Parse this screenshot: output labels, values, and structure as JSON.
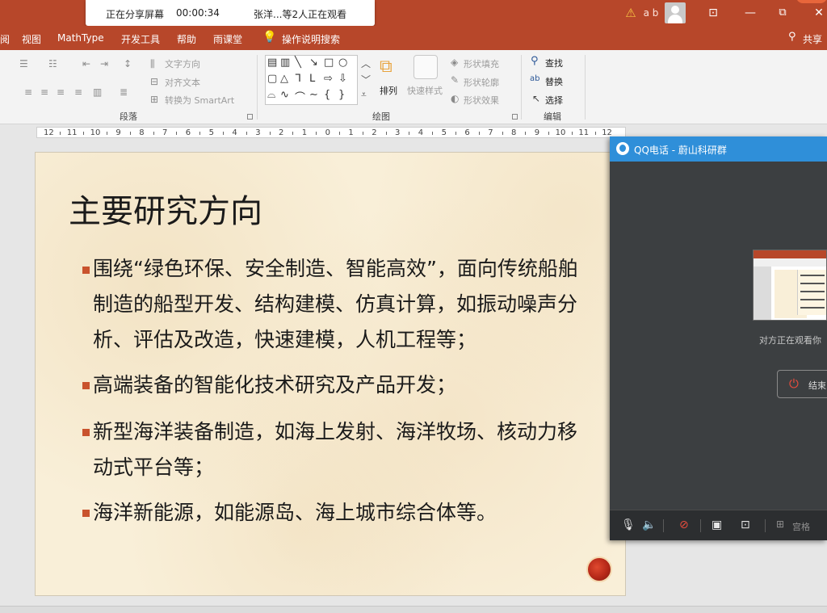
{
  "titlebar": {
    "share_status": "正在分享屏幕",
    "share_timer": "00:00:34",
    "share_viewers": "张洋...等2人正在观看",
    "user_initials": "a b",
    "warning_glyph": "⚠",
    "restore_glyph": "⧉",
    "minimize_glyph": "—",
    "close_glyph": "✕",
    "ribbon_display_glyph": "⊡"
  },
  "menu": {
    "partial_tab": "阅",
    "tabs": [
      "视图",
      "MathType",
      "开发工具",
      "帮助",
      "雨课堂"
    ],
    "search_label": "操作说明搜索",
    "share_label": "共享"
  },
  "ribbon": {
    "paragraph": {
      "label": "段落",
      "text_direction": "文字方向",
      "align_text": "对齐文本",
      "convert_smartart": "转换为 SmartArt"
    },
    "drawing": {
      "label": "绘图",
      "arrange": "排列",
      "quick_styles": "快速样式",
      "shape_fill": "形状填充",
      "shape_outline": "形状轮廓",
      "shape_effects": "形状效果"
    },
    "editing": {
      "label": "编辑",
      "find": "查找",
      "replace": "替换",
      "select": "选择"
    }
  },
  "ruler": {
    "labels": [
      "12",
      "11",
      "10",
      "9",
      "8",
      "7",
      "6",
      "5",
      "4",
      "3",
      "2",
      "1",
      "0",
      "1",
      "2",
      "3",
      "4",
      "5",
      "6",
      "7",
      "8",
      "9",
      "10",
      "11",
      "12"
    ]
  },
  "slide": {
    "title": "主要研究方向",
    "bullets": [
      "围绕“绿色环保、安全制造、智能高效”，面向传统船舶制造的船型开发、结构建模、仿真计算，如振动噪声分析、评估及改造，快速建模，人机工程等；",
      "高端装备的智能化技术研究及产品开发；",
      "新型海洋装备制造，如海上发射、海洋牧场、核动力移动式平台等；",
      "海洋新能源，如能源岛、海上城市综合体等。"
    ]
  },
  "qq_call": {
    "title": "QQ电话 - 蔚山科研群",
    "watching_text": "对方正在观看你",
    "end_label": "结束",
    "grid_label": "宫格"
  },
  "colors": {
    "accent": "#b7472a",
    "bullet": "#c9532d",
    "qq_blue": "#2f8fd9"
  }
}
